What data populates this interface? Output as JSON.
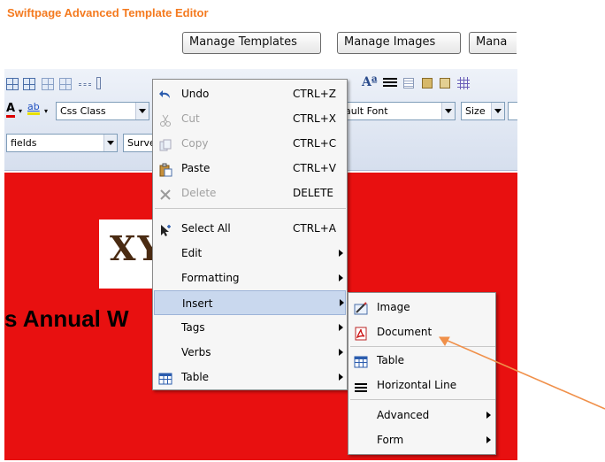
{
  "app": {
    "title": "Swiftpage Advanced Template Editor"
  },
  "top_buttons": {
    "manage_templates": "Manage Templates",
    "manage_images": "Manage Images",
    "manage_more": "Mana"
  },
  "toolbar": {
    "css_class": "Css Class",
    "font": "ault Font",
    "size": "Size",
    "fields": "fields",
    "survey": "Surve"
  },
  "canvas": {
    "logo_text": "XY",
    "heading_fragment": "s Annual W",
    "background_color": "#e81010"
  },
  "context_menu": {
    "items": [
      {
        "label": "Undo",
        "shortcut": "CTRL+Z",
        "icon": "undo-icon",
        "enabled": true
      },
      {
        "label": "Cut",
        "shortcut": "CTRL+X",
        "icon": "cut-icon",
        "enabled": false
      },
      {
        "label": "Copy",
        "shortcut": "CTRL+C",
        "icon": "copy-icon",
        "enabled": false
      },
      {
        "label": "Paste",
        "shortcut": "CTRL+V",
        "icon": "paste-icon",
        "enabled": true
      },
      {
        "label": "Delete",
        "shortcut": "DELETE",
        "icon": "delete-icon",
        "enabled": false
      },
      {
        "label": "Select All",
        "shortcut": "CTRL+A",
        "icon": "select-all-icon",
        "enabled": true
      },
      {
        "label": "Edit",
        "submenu": true
      },
      {
        "label": "Formatting",
        "submenu": true
      },
      {
        "label": "Insert",
        "submenu": true,
        "highlighted": true
      },
      {
        "label": "Tags",
        "submenu": true
      },
      {
        "label": "Verbs",
        "submenu": true
      },
      {
        "label": "Table",
        "submenu": true,
        "icon": "table-icon"
      }
    ]
  },
  "insert_submenu": {
    "items": [
      {
        "label": "Image",
        "icon": "image-icon"
      },
      {
        "label": "Document",
        "icon": "pdf-document-icon"
      },
      {
        "label": "Table",
        "icon": "table-icon"
      },
      {
        "label": "Horizontal Line",
        "icon": "horizontal-line-icon"
      },
      {
        "label": "Advanced",
        "submenu": true
      },
      {
        "label": "Form",
        "submenu": true
      }
    ]
  },
  "colors": {
    "accent": "#f47a1f",
    "annotation_arrow": "#f0904a",
    "highlight": "#c9d8ee"
  }
}
